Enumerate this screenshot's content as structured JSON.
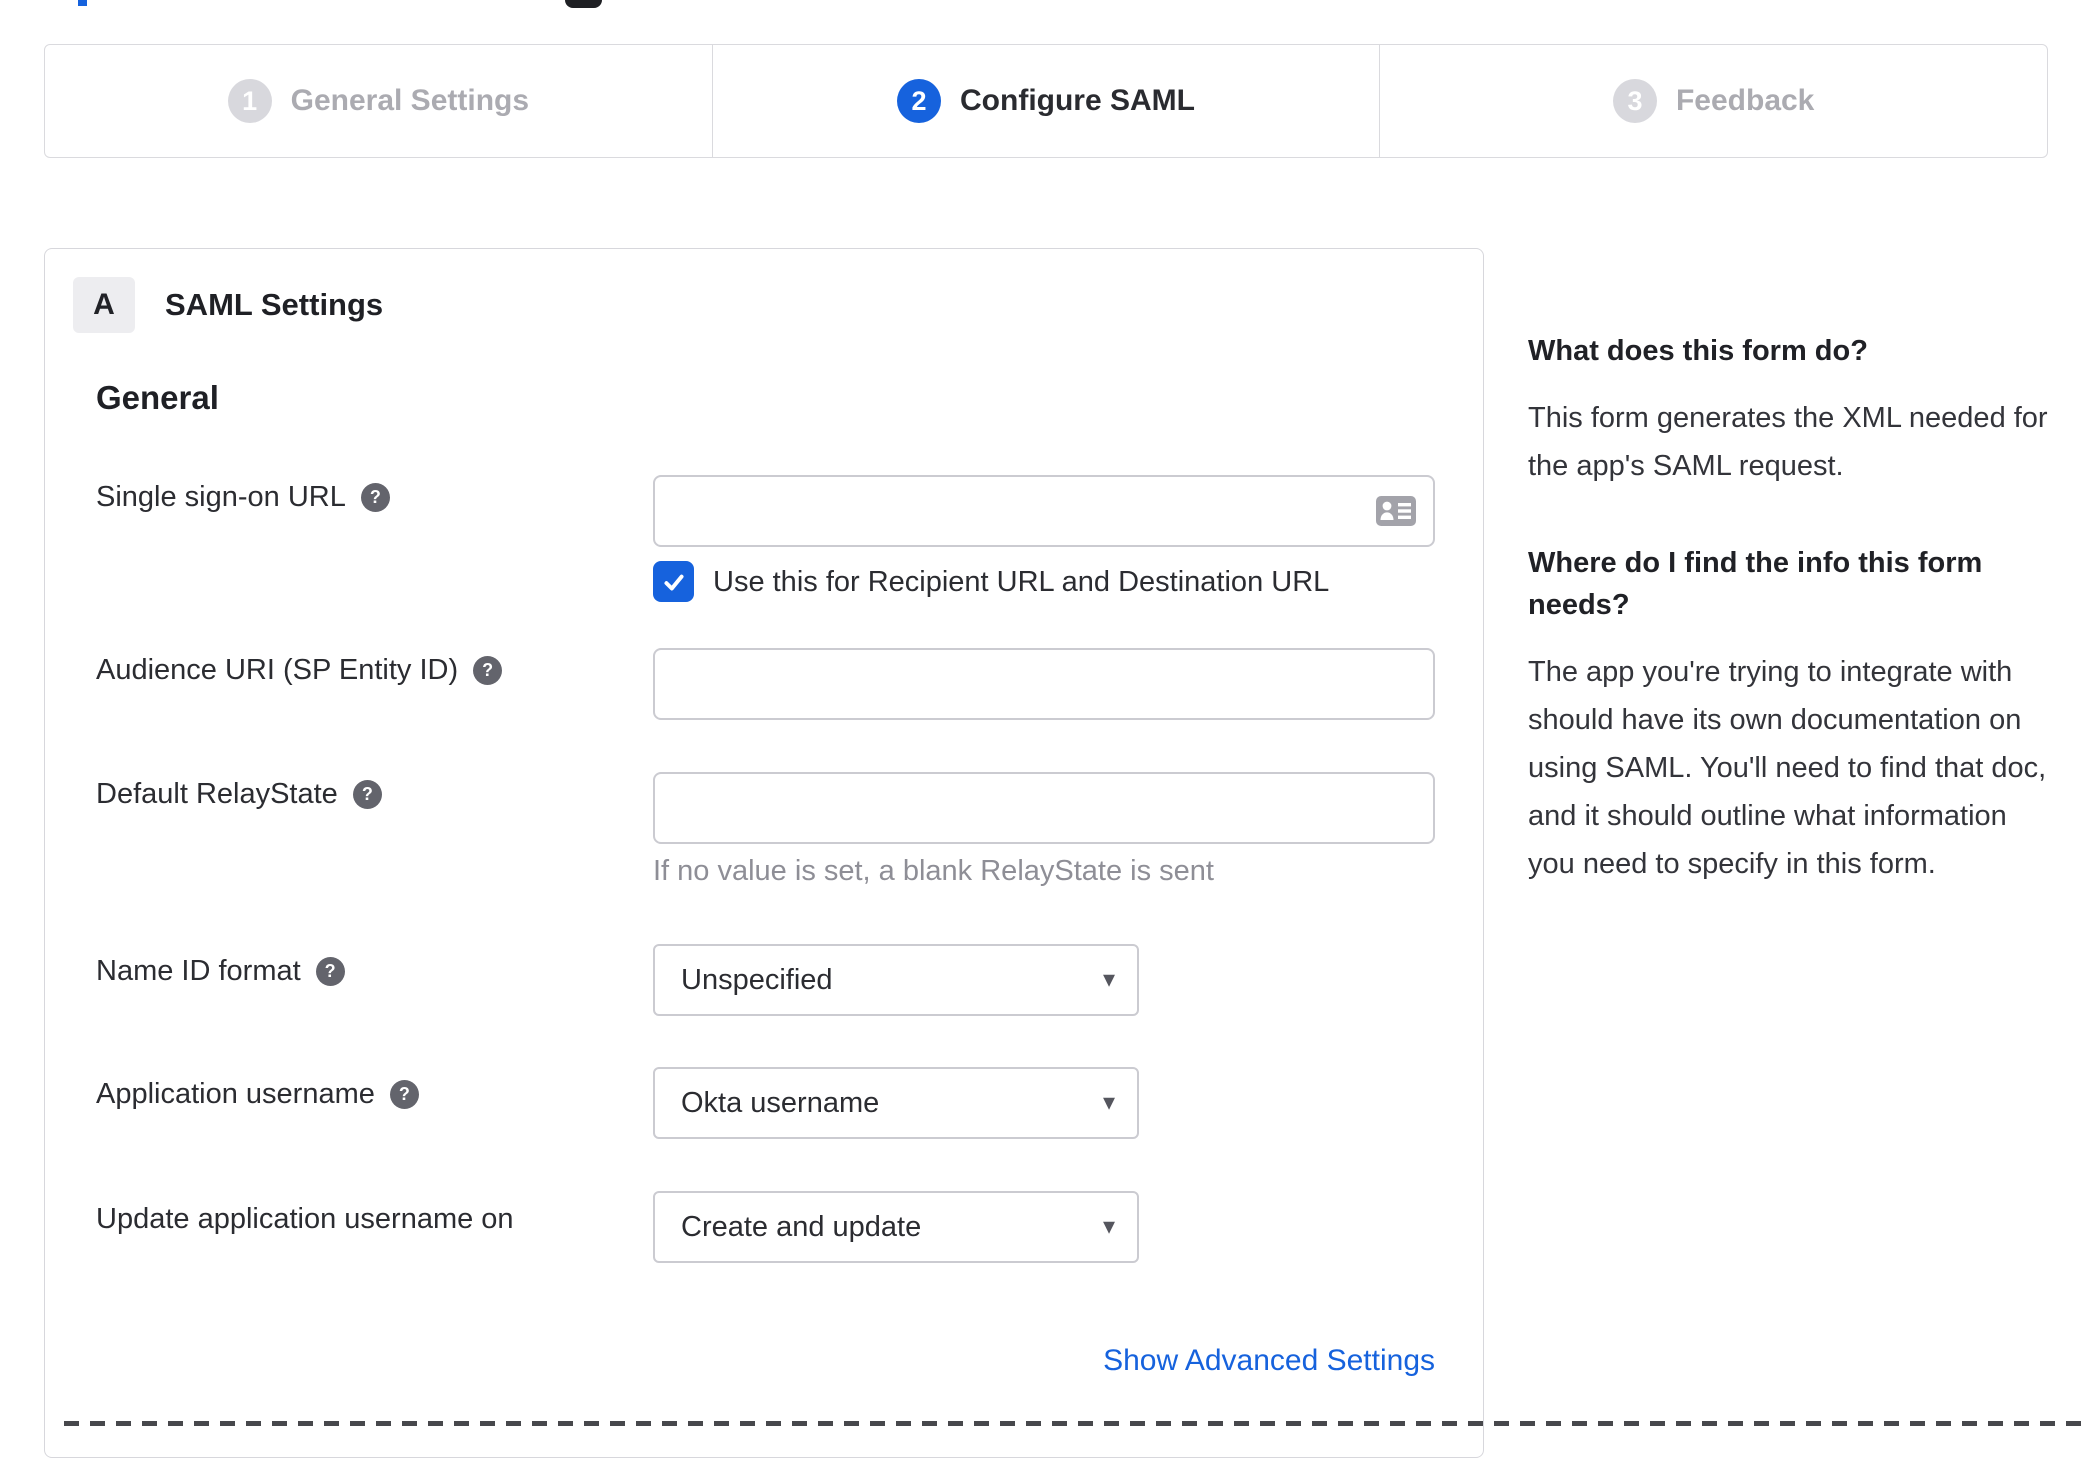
{
  "colors": {
    "accent_blue": "#1662dd",
    "inactive_step_gray": "#d8d8dd",
    "text_dark": "#2b2c31",
    "muted_gray": "#8e8e96",
    "input_border": "#cbcbd1"
  },
  "stepper": {
    "steps": [
      {
        "number": "1",
        "label": "General Settings",
        "state": "inactive"
      },
      {
        "number": "2",
        "label": "Configure SAML",
        "state": "active"
      },
      {
        "number": "3",
        "label": "Feedback",
        "state": "inactive"
      }
    ]
  },
  "panel": {
    "section_badge": "A",
    "section_title": "SAML Settings",
    "group_heading": "General",
    "fields": [
      {
        "label": "Single sign-on URL",
        "value": "",
        "checkbox_label": "Use this for Recipient URL and Destination URL",
        "checkbox_checked": true
      },
      {
        "label": "Audience URI (SP Entity ID)",
        "value": ""
      },
      {
        "label": "Default RelayState",
        "value": "",
        "hint": "If no value is set, a blank RelayState is sent"
      },
      {
        "label": "Name ID format",
        "value": "Unspecified"
      },
      {
        "label": "Application username",
        "value": "Okta username"
      },
      {
        "label": "Update application username on",
        "value": "Create and update"
      }
    ],
    "advanced_link": "Show Advanced Settings"
  },
  "sidebar": {
    "sections": [
      {
        "heading": "What does this form do?",
        "body": "This form generates the XML needed for the app's SAML request."
      },
      {
        "heading": "Where do I find the info this form needs?",
        "body": "The app you're trying to integrate with should have its own documentation on using SAML. You'll need to find that doc, and it should outline what information you need to specify in this form."
      }
    ]
  },
  "icons": {
    "help_glyph": "?",
    "caret_glyph": "▾"
  }
}
